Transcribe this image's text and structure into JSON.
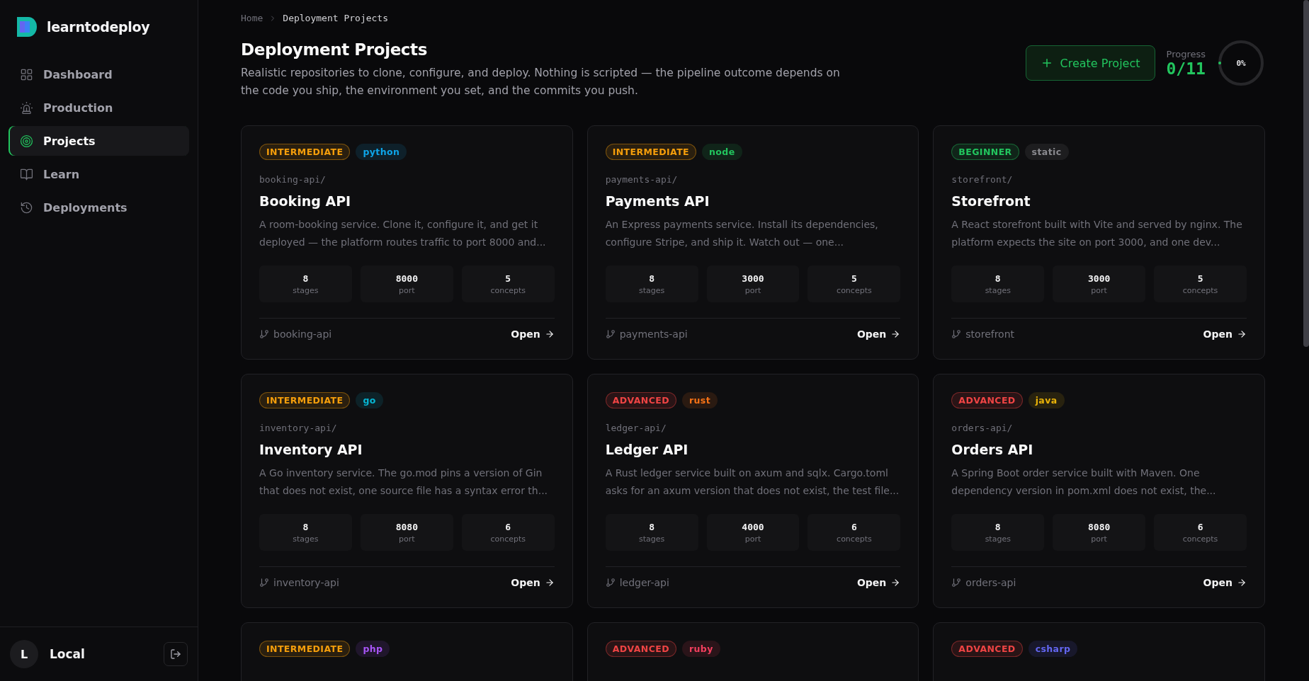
{
  "sidebar": {
    "brand": "learntodeploy",
    "items": [
      {
        "label": "Dashboard",
        "selected": false
      },
      {
        "label": "Production",
        "selected": false
      },
      {
        "label": "Projects",
        "selected": true
      },
      {
        "label": "Learn",
        "selected": false
      },
      {
        "label": "Deployments",
        "selected": false
      }
    ],
    "user": {
      "initial": "L",
      "name": "Local"
    }
  },
  "breadcrumb": [
    "Home",
    "Deployment Projects"
  ],
  "header": {
    "title": "Deployment Projects",
    "description": "Realistic repositories to clone, configure, and deploy. Nothing is scripted — the pipeline outcome depends on the code you ship, the environment you set, and the commits you push.",
    "create_button": "Create Project",
    "progress_label": "Progress",
    "progress_value": "0/11",
    "progress_percent": "0%",
    "level": 0
  },
  "projects": [
    {
      "difficulty": {
        "label": "INTERMEDIATE",
        "color": "#f59e0b"
      },
      "language": {
        "label": "python",
        "color": "#0ea5e9"
      },
      "path": "booking-api/",
      "title": "Booking API",
      "description": "A room-booking service. Clone it, configure it, and get it deployed — the platform routes traffic to port 8000 and...",
      "stats": [
        {
          "value": "8",
          "label": "stages"
        },
        {
          "value": "8000",
          "label": "port"
        },
        {
          "value": "5",
          "label": "concepts"
        }
      ],
      "repo": "booking-api",
      "action": "Open"
    },
    {
      "difficulty": {
        "label": "INTERMEDIATE",
        "color": "#f59e0b"
      },
      "language": {
        "label": "node",
        "color": "#22c55e"
      },
      "path": "payments-api/",
      "title": "Payments API",
      "description": "An Express payments service. Install its dependencies, configure Stripe, and ship it. Watch out — one...",
      "stats": [
        {
          "value": "8",
          "label": "stages"
        },
        {
          "value": "3000",
          "label": "port"
        },
        {
          "value": "5",
          "label": "concepts"
        }
      ],
      "repo": "payments-api",
      "action": "Open"
    },
    {
      "difficulty": {
        "label": "BEGINNER",
        "color": "#22c55e"
      },
      "language": {
        "label": "static",
        "color": "#8a8a8f"
      },
      "path": "storefront/",
      "title": "Storefront",
      "description": "A React storefront built with Vite and served by nginx. The platform expects the site on port 3000, and one dev...",
      "stats": [
        {
          "value": "8",
          "label": "stages"
        },
        {
          "value": "3000",
          "label": "port"
        },
        {
          "value": "5",
          "label": "concepts"
        }
      ],
      "repo": "storefront",
      "action": "Open"
    },
    {
      "difficulty": {
        "label": "INTERMEDIATE",
        "color": "#f59e0b"
      },
      "language": {
        "label": "go",
        "color": "#06b6d4"
      },
      "path": "inventory-api/",
      "title": "Inventory API",
      "description": "A Go inventory service. The go.mod pins a version of Gin that does not exist, one source file has a syntax error th...",
      "stats": [
        {
          "value": "8",
          "label": "stages"
        },
        {
          "value": "8080",
          "label": "port"
        },
        {
          "value": "6",
          "label": "concepts"
        }
      ],
      "repo": "inventory-api",
      "action": "Open"
    },
    {
      "difficulty": {
        "label": "ADVANCED",
        "color": "#ef4444"
      },
      "language": {
        "label": "rust",
        "color": "#f97316"
      },
      "path": "ledger-api/",
      "title": "Ledger API",
      "description": "A Rust ledger service built on axum and sqlx. Cargo.toml asks for an axum version that does not exist, the test file...",
      "stats": [
        {
          "value": "8",
          "label": "stages"
        },
        {
          "value": "4000",
          "label": "port"
        },
        {
          "value": "6",
          "label": "concepts"
        }
      ],
      "repo": "ledger-api",
      "action": "Open"
    },
    {
      "difficulty": {
        "label": "ADVANCED",
        "color": "#ef4444"
      },
      "language": {
        "label": "java",
        "color": "#eab308"
      },
      "path": "orders-api/",
      "title": "Orders API",
      "description": "A Spring Boot order service built with Maven. One dependency version in pom.xml does not exist, the...",
      "stats": [
        {
          "value": "8",
          "label": "stages"
        },
        {
          "value": "8080",
          "label": "port"
        },
        {
          "value": "6",
          "label": "concepts"
        }
      ],
      "repo": "orders-api",
      "action": "Open"
    },
    {
      "difficulty": {
        "label": "INTERMEDIATE",
        "color": "#f59e0b"
      },
      "language": {
        "label": "php",
        "color": "#a855f7"
      }
    },
    {
      "difficulty": {
        "label": "ADVANCED",
        "color": "#ef4444"
      },
      "language": {
        "label": "ruby",
        "color": "#f43f5e"
      }
    },
    {
      "difficulty": {
        "label": "ADVANCED",
        "color": "#ef4444"
      },
      "language": {
        "label": "csharp",
        "color": "#6366f1"
      }
    }
  ]
}
